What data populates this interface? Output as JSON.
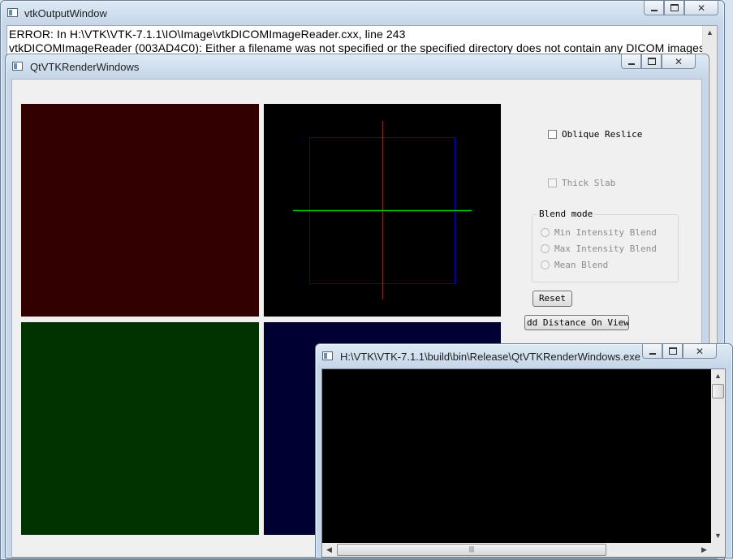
{
  "output_window": {
    "title": "vtkOutputWindow",
    "lines": [
      "ERROR: In H:\\VTK\\VTK-7.1.1\\IO\\Image\\vtkDICOMImageReader.cxx, line 243",
      "vtkDICOMImageReader (003AD4C0): Either a filename was not specified or the specified directory does not contain any DICOM images"
    ]
  },
  "qt_window": {
    "title": "QtVTKRenderWindows",
    "views": {
      "top_left_color": "#330000",
      "top_right_color": "#000000",
      "bottom_left_color": "#003300",
      "bottom_right_color": "#000033",
      "cursor_colors": {
        "vertical": "#cc0000",
        "horizontal": "#00cc00",
        "frame": "#0000cc"
      }
    },
    "controls": {
      "oblique_reslice": {
        "label": "Oblique Reslice",
        "checked": false
      },
      "thick_slab": {
        "label": "Thick Slab",
        "checked": false,
        "enabled": false
      },
      "blend_mode": {
        "title": "Blend mode",
        "options": [
          "Min Intensity Blend",
          "Max Intensity Blend",
          "Mean Blend"
        ]
      },
      "reset_label": "Reset",
      "add_distance_label": "dd Distance On View :"
    }
  },
  "console_window": {
    "title": "H:\\VTK\\VTK-7.1.1\\build\\bin\\Release\\QtVTKRenderWindows.exe",
    "scroll_grip": "|||"
  }
}
